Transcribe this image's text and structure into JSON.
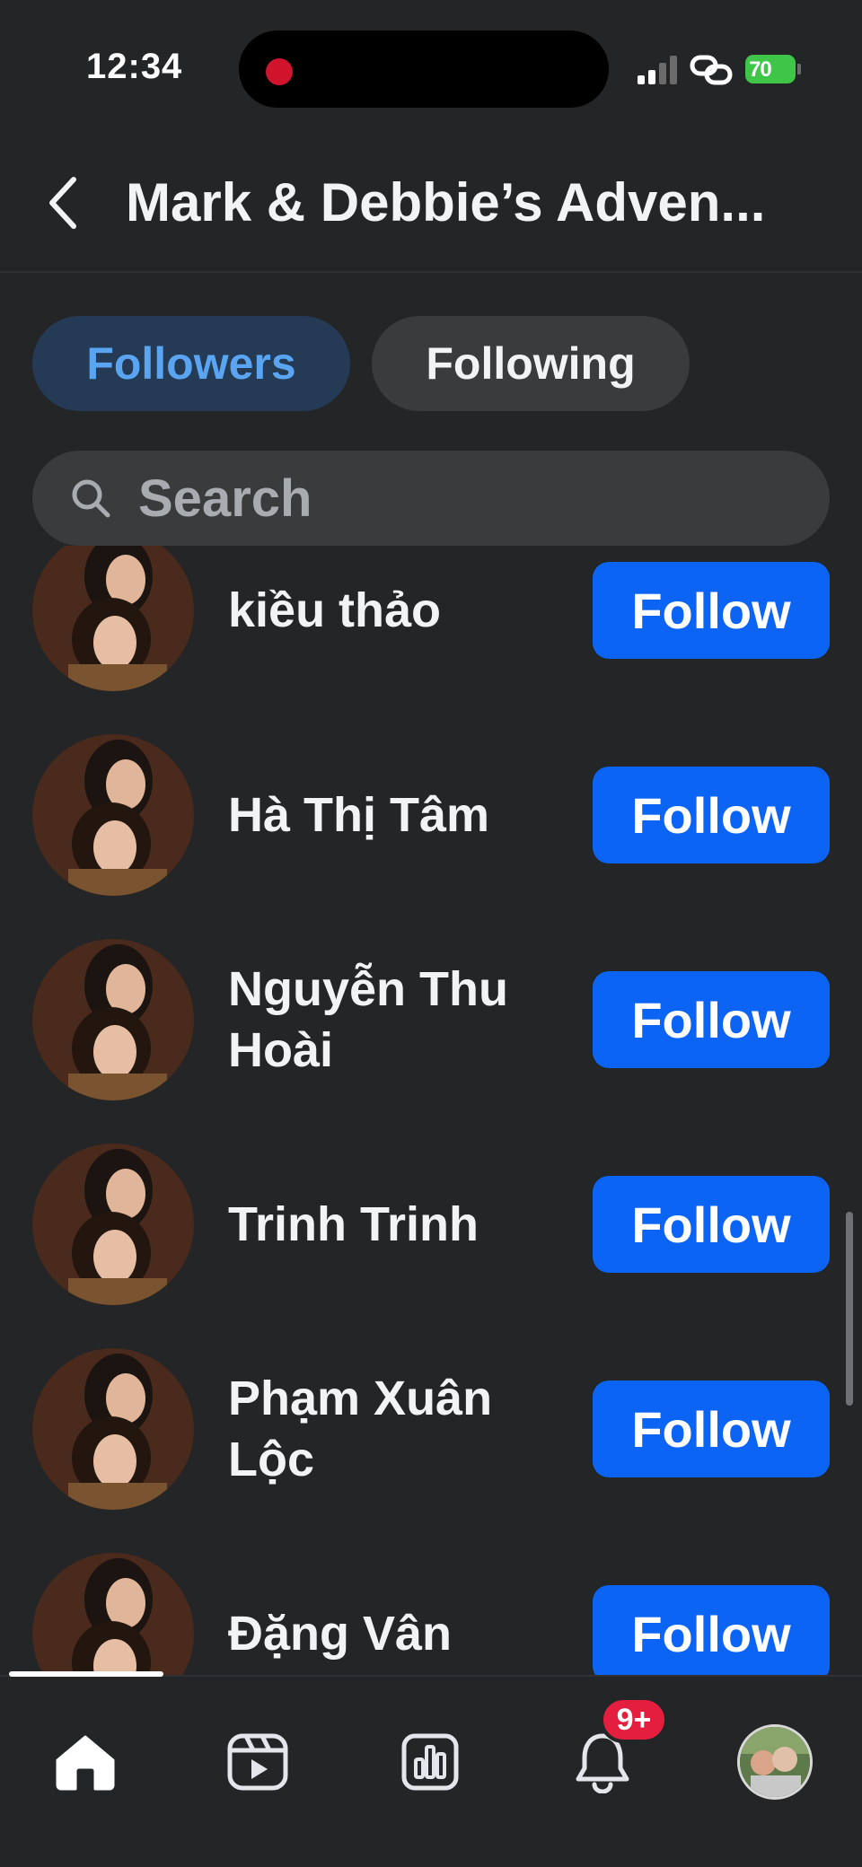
{
  "status_bar": {
    "time": "12:34",
    "battery": "70"
  },
  "header": {
    "title": "Mark & Debbie’s Adven..."
  },
  "tabs": [
    {
      "label": "Followers",
      "active": true
    },
    {
      "label": "Following",
      "active": false
    }
  ],
  "search": {
    "placeholder": "Search",
    "value": ""
  },
  "followers": [
    {
      "name": "kiều thảo",
      "button": "Follow"
    },
    {
      "name": "Hà Thị Tâm",
      "button": "Follow"
    },
    {
      "name": "Nguyễn Thu Hoài",
      "button": "Follow"
    },
    {
      "name": "Trinh Trinh",
      "button": "Follow"
    },
    {
      "name": "Phạm Xuân Lộc",
      "button": "Follow"
    },
    {
      "name": "Đặng Vân",
      "button": "Follow"
    }
  ],
  "bottom_nav": {
    "items": [
      "home-icon",
      "video-icon",
      "dashboard-icon",
      "bell-icon",
      "profile-avatar"
    ],
    "notification_badge": "9+"
  },
  "colors": {
    "background": "#232527",
    "accent": "#0b64f4",
    "active_tab_bg": "#243a55",
    "active_tab_text": "#5aa5f2",
    "badge": "#e41e3f",
    "battery": "#3fc548"
  }
}
